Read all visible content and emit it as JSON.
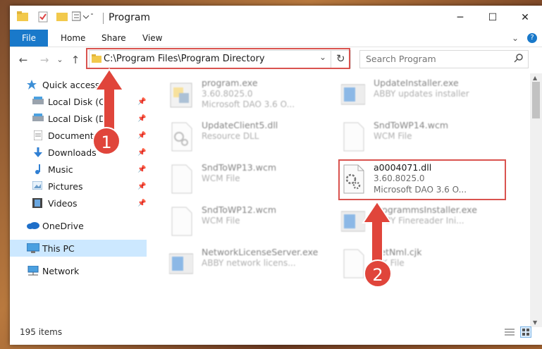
{
  "window": {
    "title": "Program",
    "controls": {
      "minimize": "─",
      "maximize": "☐",
      "close": "✕"
    }
  },
  "ribbon": {
    "tabs": [
      "File",
      "Home",
      "Share",
      "View"
    ],
    "expand_label": "⌄",
    "help_label": "?"
  },
  "address": {
    "path": "C:\\Program Files\\Program Directory",
    "dropdown_glyph": "⌄",
    "refresh_glyph": "↻"
  },
  "search": {
    "placeholder": "Search Program"
  },
  "nav": {
    "back": "←",
    "forward": "→",
    "recent": "⌄",
    "up": "↑",
    "items": [
      {
        "label": "Quick access",
        "icon": "star-icon",
        "pinned": false
      },
      {
        "label": "Local Disk (C:)",
        "icon": "drive-icon",
        "pinned": true
      },
      {
        "label": "Local Disk (D:)",
        "icon": "drive-icon",
        "pinned": true
      },
      {
        "label": "Documents",
        "icon": "documents-icon",
        "pinned": true
      },
      {
        "label": "Downloads",
        "icon": "downloads-icon",
        "pinned": true
      },
      {
        "label": "Music",
        "icon": "music-icon",
        "pinned": true
      },
      {
        "label": "Pictures",
        "icon": "pictures-icon",
        "pinned": true
      },
      {
        "label": "Videos",
        "icon": "videos-icon",
        "pinned": true
      },
      {
        "label": "OneDrive",
        "icon": "onedrive-icon",
        "pinned": false
      },
      {
        "label": "This PC",
        "icon": "pc-icon",
        "pinned": false,
        "selected": true
      },
      {
        "label": "Network",
        "icon": "network-icon",
        "pinned": false
      }
    ]
  },
  "files": [
    {
      "name": "program.exe",
      "line2": "3.60.8025.0",
      "line3": "Microsoft DAO 3.6 O...",
      "icon": "exe-icon"
    },
    {
      "name": "UpdateInstaller.exe",
      "line2": "ABBY updates installer",
      "line3": "",
      "icon": "installer-icon"
    },
    {
      "name": "UpdateClient5.dll",
      "line2": "Resource DLL",
      "line3": "",
      "icon": "dll-icon"
    },
    {
      "name": "SndToWP14.wcm",
      "line2": "WCM File",
      "line3": "",
      "icon": "file-icon"
    },
    {
      "name": "SndToWP13.wcm",
      "line2": "WCM File",
      "line3": "",
      "icon": "file-icon"
    },
    {
      "name": "a0004071.dll",
      "line2": "3.60.8025.0",
      "line3": "Microsoft DAO 3.6 O...",
      "icon": "dll-icon",
      "highlighted": true
    },
    {
      "name": "SndToWP12.wcm",
      "line2": "WCM File",
      "line3": "",
      "icon": "file-icon"
    },
    {
      "name": "ProgrammsInstaller.exe",
      "line2": "ABBY Finereader Ini...",
      "line3": "",
      "icon": "installer-icon"
    },
    {
      "name": "NetworkLicenseServer.exe",
      "line2": "ABBY network licens...",
      "line3": "",
      "icon": "installer-icon"
    },
    {
      "name": "NetNml.cjk",
      "line2": "CJK File",
      "line3": "",
      "icon": "file-icon"
    }
  ],
  "status": {
    "item_count": "195 items"
  },
  "callouts": [
    "1",
    "2"
  ],
  "colors": {
    "accent": "#1979ca",
    "highlight_box": "#d9534f",
    "callout": "#e0453b",
    "selection": "#cce8ff"
  }
}
